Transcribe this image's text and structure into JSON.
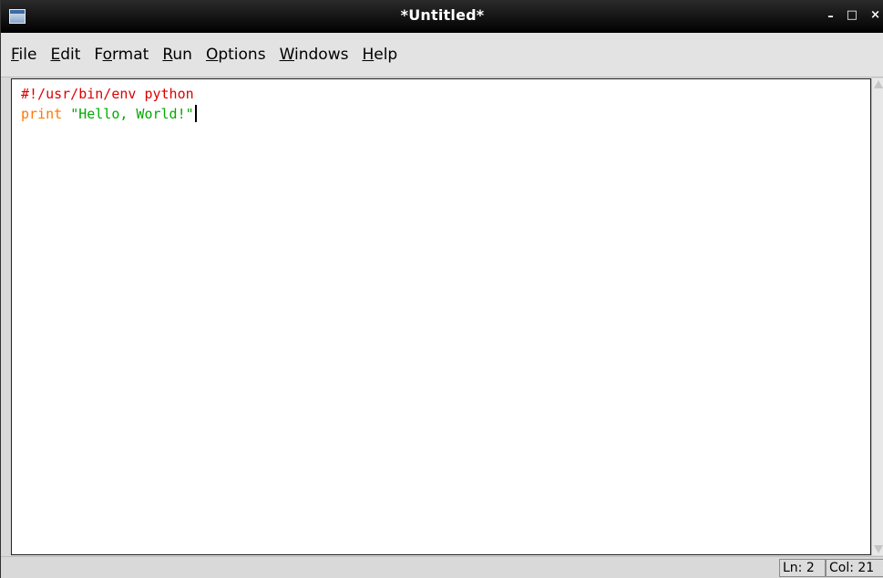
{
  "window": {
    "title": "*Untitled*",
    "controls": {
      "minimize": "–",
      "maximize": "□",
      "close": "×"
    }
  },
  "menu": {
    "items": [
      {
        "label": "File",
        "underline_index": 0
      },
      {
        "label": "Edit",
        "underline_index": 0
      },
      {
        "label": "Format",
        "underline_index": 1
      },
      {
        "label": "Run",
        "underline_index": 0
      },
      {
        "label": "Options",
        "underline_index": 0
      },
      {
        "label": "Windows",
        "underline_index": 0
      },
      {
        "label": "Help",
        "underline_index": 0
      }
    ]
  },
  "editor": {
    "lines": [
      [
        {
          "text": "#!/usr/bin/env python",
          "type": "comment"
        }
      ],
      [
        {
          "text": "print",
          "type": "keyword"
        },
        {
          "text": " ",
          "type": "plain"
        },
        {
          "text": "\"Hello, World!\"",
          "type": "string"
        }
      ]
    ],
    "cursor_line": 1
  },
  "status": {
    "line": "Ln: 2",
    "column": "Col: 21"
  },
  "colors": {
    "comment": "#dd0000",
    "keyword": "#ff7700",
    "string": "#00aa00"
  }
}
